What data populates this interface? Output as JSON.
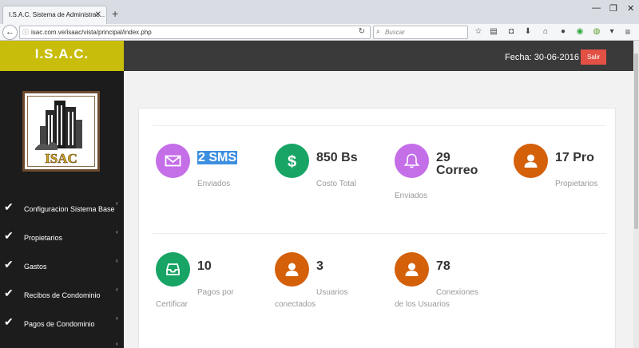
{
  "browser": {
    "tab_title": "I.S.A.C. Sistema de Administrac...",
    "url": "isac.com.ve/isaac/vista/principal/index.php",
    "search_placeholder": "Buscar"
  },
  "header": {
    "brand": "I.S.A.C.",
    "date_label": "Fecha: 30-06-2016",
    "logout_label": "Salir"
  },
  "sidebar": {
    "logo_text": "ISAC",
    "items": [
      {
        "label": "Configuracion Sistema Base"
      },
      {
        "label": "Propietarios"
      },
      {
        "label": "Gastos"
      },
      {
        "label": "Recibos de Condominio"
      },
      {
        "label": "Pagos de Condominio"
      }
    ]
  },
  "stats": [
    {
      "value": "2 SMS",
      "sub": "Enviados",
      "color": "#c46ee8",
      "icon": "envelope-icon"
    },
    {
      "value": "850 Bs",
      "sub": "Costo Total",
      "color": "#17a464",
      "icon": "dollar-icon"
    },
    {
      "value_line1": "29",
      "value_line2": "Correo",
      "sub": "Enviados",
      "color": "#c46ee8",
      "icon": "bell-icon"
    },
    {
      "value": "17 Pro",
      "sub": "Propietarios",
      "color": "#d4600a",
      "icon": "user-icon"
    },
    {
      "value": "10",
      "sub_line1": "Pagos por",
      "sub_line2": "Certificar",
      "color": "#17a464",
      "icon": "inbox-icon"
    },
    {
      "value": "3",
      "sub_line1": "Usuarios",
      "sub_line2": "conectados",
      "color": "#d4600a",
      "icon": "user-icon"
    },
    {
      "value": "78",
      "sub_line1": "Conexiones",
      "sub_line2": "de los Usuarios",
      "color": "#d4600a",
      "icon": "user-icon"
    }
  ]
}
